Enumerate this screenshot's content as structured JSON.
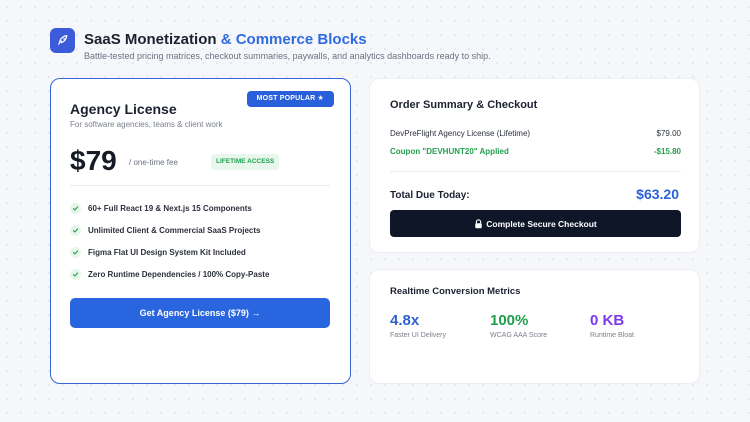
{
  "header": {
    "title_main": "SaaS Monetization",
    "title_accent": " & Commerce Blocks",
    "subtitle": "Battle-tested pricing matrices, checkout summaries, paywalls, and analytics dashboards ready to ship.",
    "logo_icon": "rocket-icon"
  },
  "license": {
    "badge": "MOST POPULAR ★",
    "title": "Agency License",
    "subtitle": "For software agencies, teams & client work",
    "price": "$79",
    "price_note": "/ one-time fee",
    "pill": "LIFETIME ACCESS",
    "features": [
      "60+ Full React 19 & Next.js 15 Components",
      "Unlimited Client & Commercial SaaS Projects",
      "Figma Flat UI Design System Kit Included",
      "Zero Runtime Dependencies / 100% Copy-Paste"
    ],
    "cta": "Get Agency License ($79) →"
  },
  "order": {
    "title": "Order Summary & Checkout",
    "item_label": "DevPreFlight Agency License (Lifetime)",
    "item_value": "$79.00",
    "coupon_label": "Coupon \"DEVHUNT20\" Applied",
    "coupon_value": "-$15.80",
    "total_label": "Total Due Today:",
    "total_value": "$63.20",
    "checkout_label": "Complete Secure Checkout"
  },
  "metrics": {
    "title": "Realtime Conversion Metrics",
    "items": [
      {
        "value": "4.8x",
        "label": "Faster UI Delivery"
      },
      {
        "value": "100%",
        "label": "WCAG AAA Score"
      },
      {
        "value": "0 KB",
        "label": "Runtime Bloat"
      }
    ]
  },
  "colors": {
    "brand": "#2a65e0",
    "success": "#22a04f",
    "metric_purple": "#7c3aed",
    "checkout_dark": "#0e1628"
  }
}
